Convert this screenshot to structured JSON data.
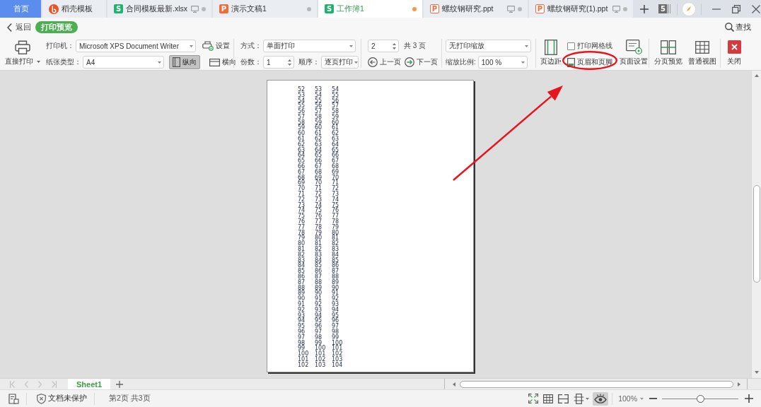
{
  "tabs": [
    {
      "label": "首页",
      "kind": "home",
      "selected": false
    },
    {
      "label": "稻壳模板",
      "kind": "docer",
      "selected": false
    },
    {
      "label": "合同模板最新.xlsx",
      "kind": "sheet",
      "app_letter": "S",
      "selected": false,
      "monitor": true,
      "modified": false
    },
    {
      "label": "演示文稿1",
      "kind": "slides",
      "app_letter": "P",
      "selected": false,
      "monitor": false,
      "modified": false
    },
    {
      "label": "工作簿1",
      "kind": "sheet",
      "app_letter": "S",
      "selected": true,
      "monitor": false,
      "modified": true
    },
    {
      "label": "螺纹钢研究.ppt",
      "kind": "ppt",
      "app_letter": "P",
      "selected": false,
      "monitor": true,
      "modified": false
    },
    {
      "label": "螺纹钢研究(1).ppt",
      "kind": "ppt",
      "app_letter": "P",
      "selected": false,
      "monitor": true,
      "modified": false
    }
  ],
  "tab_count": "5",
  "toolbar": {
    "back": "返回",
    "mode_badge": "打印预览",
    "search": "查找",
    "print": "直接打印",
    "printer_label": "打印机：",
    "printer": "Microsoft XPS Document Writer",
    "printer_settings": "设置",
    "paper_label": "纸张类型：",
    "paper": "A4",
    "orientations": [
      {
        "label": "纵向",
        "kind": "portrait",
        "selected": true
      },
      {
        "label": "横向",
        "kind": "landscape",
        "selected": false
      }
    ],
    "duplex_label": "方式：",
    "duplex": "单面打印",
    "copies_label": "份数：",
    "copies": "1",
    "order_label": "顺序：",
    "order": "逐页打印",
    "page": "2",
    "page_total": "共 3 页",
    "prev": "上一页",
    "next": "下一页",
    "scaling": "无打印缩放",
    "zoom_label": "缩放比例:",
    "zoom": "100 %",
    "margins": "页边距",
    "gridlines": {
      "label": "打印网格线",
      "checked": false
    },
    "header_footer": "页眉和页脚",
    "page_setup": "页面设置",
    "views": [
      {
        "label": "分页预览",
        "kind": "page-break"
      },
      {
        "label": "普通视图",
        "kind": "normal"
      }
    ],
    "close": "关闭"
  },
  "preview_page": {
    "rows": [
      [
        "52",
        "53",
        "54"
      ],
      [
        "53",
        "54",
        "55"
      ],
      [
        "54",
        "55",
        "56"
      ],
      [
        "55",
        "56",
        "57"
      ],
      [
        "56",
        "57",
        "58"
      ],
      [
        "57",
        "58",
        "59"
      ],
      [
        "58",
        "59",
        "60"
      ],
      [
        "59",
        "60",
        "61"
      ],
      [
        "60",
        "61",
        "62"
      ],
      [
        "61",
        "62",
        "63"
      ],
      [
        "62",
        "63",
        "64"
      ],
      [
        "63",
        "64",
        "65"
      ],
      [
        "64",
        "65",
        "66"
      ],
      [
        "65",
        "66",
        "67"
      ],
      [
        "66",
        "67",
        "68"
      ],
      [
        "67",
        "68",
        "69"
      ],
      [
        "68",
        "69",
        "70"
      ],
      [
        "69",
        "70",
        "71"
      ],
      [
        "70",
        "71",
        "72"
      ],
      [
        "71",
        "72",
        "73"
      ],
      [
        "72",
        "73",
        "74"
      ],
      [
        "73",
        "74",
        "75"
      ],
      [
        "74",
        "75",
        "76"
      ],
      [
        "75",
        "76",
        "77"
      ],
      [
        "76",
        "77",
        "78"
      ],
      [
        "77",
        "78",
        "79"
      ],
      [
        "78",
        "79",
        "80"
      ],
      [
        "79",
        "80",
        "81"
      ],
      [
        "80",
        "81",
        "82"
      ],
      [
        "81",
        "82",
        "83"
      ],
      [
        "82",
        "83",
        "84"
      ],
      [
        "83",
        "84",
        "85"
      ],
      [
        "84",
        "85",
        "86"
      ],
      [
        "85",
        "86",
        "87"
      ],
      [
        "86",
        "87",
        "88"
      ],
      [
        "87",
        "88",
        "89"
      ],
      [
        "88",
        "89",
        "90"
      ],
      [
        "89",
        "90",
        "91"
      ],
      [
        "90",
        "91",
        "92"
      ],
      [
        "91",
        "92",
        "93"
      ],
      [
        "92",
        "93",
        "94"
      ],
      [
        "93",
        "94",
        "95"
      ],
      [
        "94",
        "95",
        "96"
      ],
      [
        "95",
        "96",
        "97"
      ],
      [
        "96",
        "97",
        "98"
      ],
      [
        "97",
        "98",
        "99"
      ],
      [
        "98",
        "99",
        "100"
      ],
      [
        "99",
        "100",
        "101"
      ],
      [
        "100",
        "101",
        "102"
      ],
      [
        "101",
        "102",
        "103"
      ],
      [
        "102",
        "103",
        "104"
      ]
    ]
  },
  "sheet_tabs": [
    {
      "label": "Sheet1",
      "selected": true
    }
  ],
  "status_bar": {
    "protection": "文档未保护",
    "page_info": "第2页 共3页",
    "view_modes": [
      {
        "kind": "fullscreen",
        "selected": false
      },
      {
        "kind": "grid",
        "selected": false
      },
      {
        "kind": "split",
        "selected": false
      },
      {
        "kind": "layout",
        "selected": false
      },
      {
        "kind": "eye",
        "selected": true
      }
    ],
    "zoom": "100%",
    "zoom_slider": {
      "level": 0.5
    }
  }
}
